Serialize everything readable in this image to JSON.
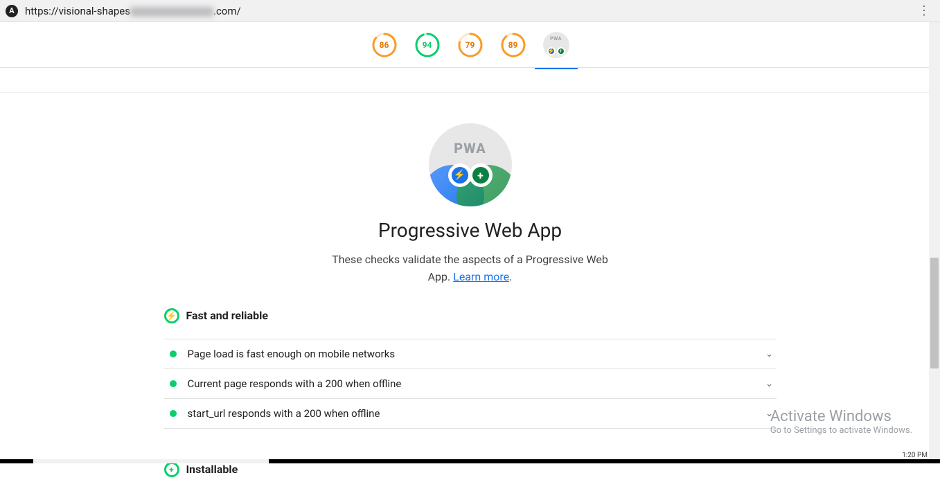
{
  "browser": {
    "url_visible_prefix": "https://visional-shapes",
    "url_visible_suffix": ".com/",
    "clock": "1:20 PM"
  },
  "scores": [
    {
      "value": 86,
      "color": "orange"
    },
    {
      "value": 94,
      "color": "green"
    },
    {
      "value": 79,
      "color": "orange"
    },
    {
      "value": 89,
      "color": "orange"
    }
  ],
  "hero": {
    "badge_text": "PWA",
    "title": "Progressive Web App",
    "subtitle_before_link": "These checks validate the aspects of a Progressive Web App. ",
    "link_text": "Learn more",
    "period": "."
  },
  "groups": [
    {
      "icon": "bolt",
      "title": "Fast and reliable",
      "audits": [
        "Page load is fast enough on mobile networks",
        "Current page responds with a 200 when offline",
        "start_url responds with a 200 when offline"
      ]
    },
    {
      "icon": "plus",
      "title": "Installable",
      "audits": []
    }
  ],
  "watermark": {
    "line1": "Activate Windows",
    "line2": "Go to Settings to activate Windows."
  },
  "colors": {
    "orange": "#fa9b28",
    "green": "#0cce6b"
  }
}
